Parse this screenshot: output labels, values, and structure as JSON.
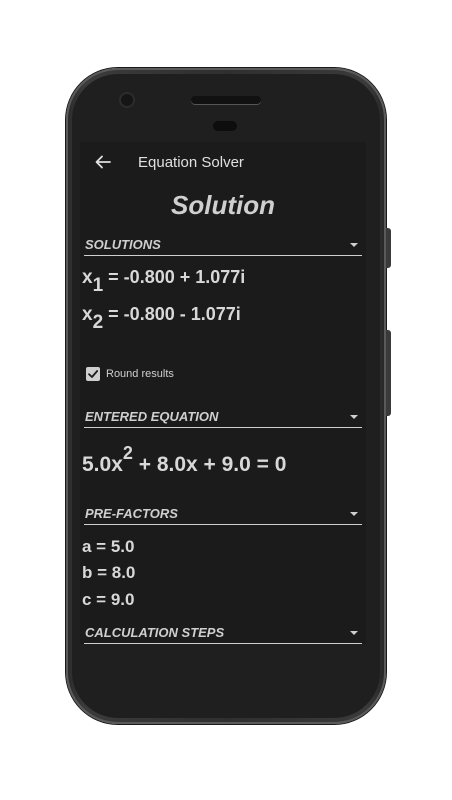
{
  "appbar": {
    "title": "Equation Solver"
  },
  "page_title": "Solution",
  "sections": {
    "solutions": "SOLUTIONS",
    "entered_equation": "ENTERED EQUATION",
    "pre_factors": "PRE-FACTORS",
    "calculation_steps": "CALCULATION STEPS"
  },
  "solutions": [
    {
      "var": "x",
      "sub": "1",
      "value": "=  -0.800 + 1.077i"
    },
    {
      "var": "x",
      "sub": "2",
      "value": "=  -0.800 - 1.077i"
    }
  ],
  "round_results": {
    "label": "Round results",
    "checked": true
  },
  "equation": {
    "part1": "5.0x",
    "exp": "2",
    "part2": " + 8.0x + 9.0 = 0"
  },
  "pre_factors": {
    "a": "a = 5.0",
    "b": "b = 8.0",
    "c": "c = 9.0"
  },
  "colors": {
    "screen_bg": "#1b1b1b",
    "text": "#d8d8d8",
    "phone_body": "#2f2f2f"
  }
}
